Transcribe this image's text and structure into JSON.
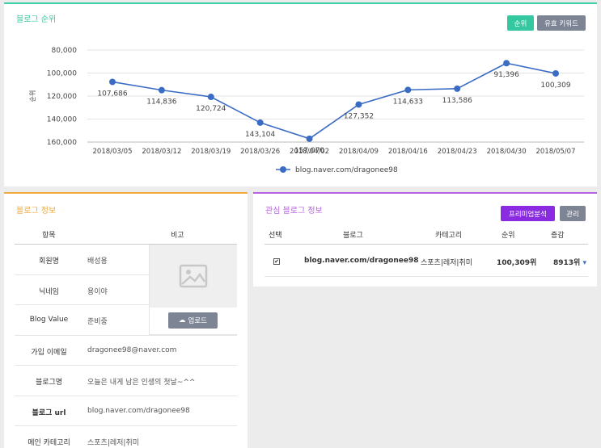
{
  "rank": {
    "title": "블로그 순위",
    "btn_rank": "순위",
    "btn_keyword": "유효 키워드"
  },
  "chart_data": {
    "type": "line",
    "ylabel": "순위",
    "y_reversed": true,
    "ylim": [
      80000,
      160000
    ],
    "yticks": [
      "80,000",
      "100,000",
      "120,000",
      "140,000",
      "160,000"
    ],
    "categories": [
      "2018/03/05",
      "2018/03/12",
      "2018/03/19",
      "2018/03/26",
      "2018/04/02",
      "2018/04/09",
      "2018/04/16",
      "2018/04/23",
      "2018/04/30",
      "2018/05/07"
    ],
    "series": [
      {
        "name": "blog.naver.com/dragonee98",
        "values": [
          107686,
          114836,
          120724,
          143104,
          157070,
          127352,
          114633,
          113586,
          91396,
          100309
        ],
        "labels": [
          "107,686",
          "114,836",
          "120,724",
          "143,104",
          "157,070",
          "127,352",
          "114,633",
          "113,586",
          "91,396",
          "100,309"
        ]
      }
    ],
    "color": "#3b6cc4",
    "grid": true,
    "legend": "bottom"
  },
  "info": {
    "title": "블로그 정보",
    "head_item": "항목",
    "head_note": "비고",
    "rows": [
      {
        "k": "회원명",
        "v": "배성용"
      },
      {
        "k": "닉네임",
        "v": "용이야"
      },
      {
        "k": "Blog Value",
        "v": "준비중"
      },
      {
        "k": "가입 이메일",
        "v": "dragonee98@naver.com"
      },
      {
        "k": "블로그명",
        "v": "오늘은 내게 남은 인생의 첫날~^^"
      },
      {
        "k": "블로그 url",
        "v": "blog.naver.com/dragonee98"
      },
      {
        "k": "메인 카테고리",
        "v": "스포츠|레저|취미"
      }
    ],
    "upload_label": "업로드"
  },
  "interest": {
    "title": "관심 블로그 정보",
    "btn_premium": "프리미엄분석",
    "btn_manage": "관리",
    "headers": [
      "선택",
      "블로그",
      "카테고리",
      "순위",
      "증감"
    ],
    "row": {
      "check": "✔",
      "blog": "blog.naver.com/dragonee98",
      "category": "스포츠|레저|취미",
      "rank": "100,309위",
      "delta": "8913위"
    }
  }
}
